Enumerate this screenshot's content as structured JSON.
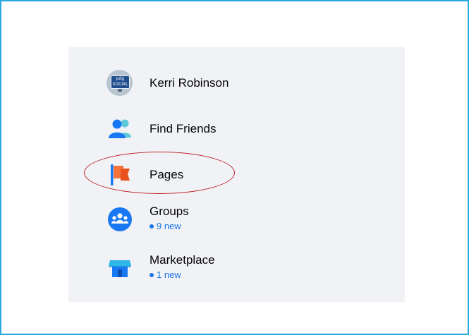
{
  "menu": {
    "items": [
      {
        "label": "Kerri Robinson",
        "icon": "profile-avatar-icon",
        "avatar_text_top": "pdg",
        "avatar_text_bottom": "SOCIAL"
      },
      {
        "label": "Find Friends",
        "icon": "friends-icon"
      },
      {
        "label": "Pages",
        "icon": "flag-icon"
      },
      {
        "label": "Groups",
        "icon": "groups-icon",
        "badge": "9 new"
      },
      {
        "label": "Marketplace",
        "icon": "marketplace-icon",
        "badge": "1 new"
      }
    ]
  },
  "colors": {
    "frame_border": "#29a9e0",
    "panel_bg": "#f0f2f5",
    "accent_blue": "#1b74e4",
    "highlight_ellipse": "#c0272d"
  }
}
